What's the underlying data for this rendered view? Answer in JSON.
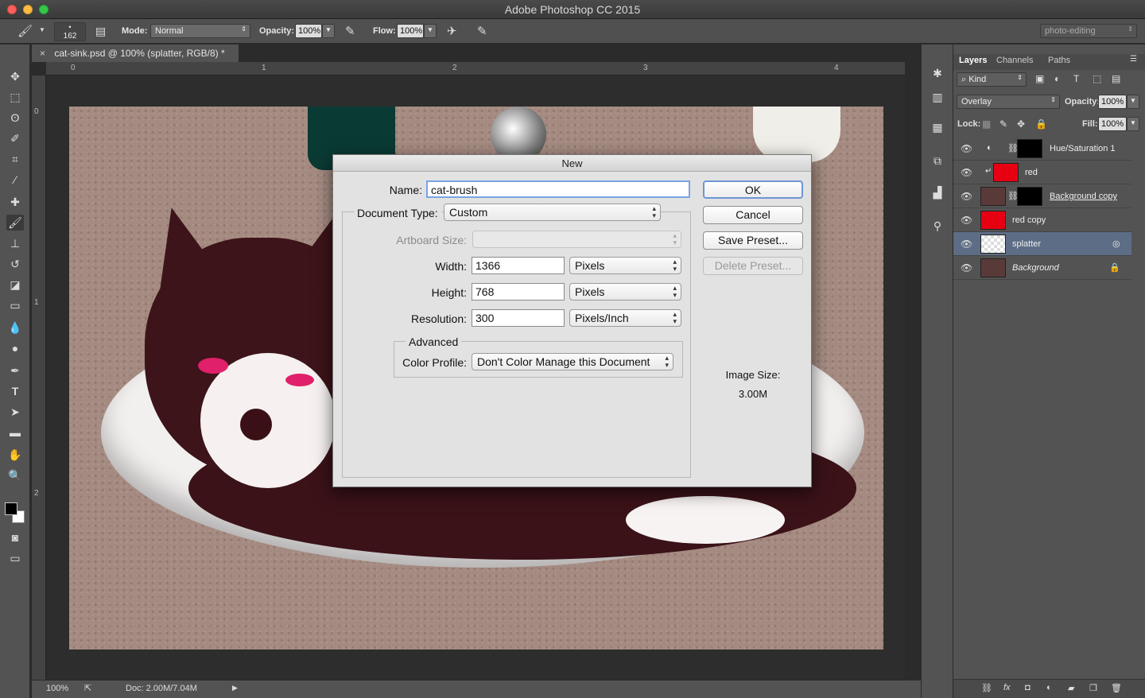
{
  "app": {
    "title": "Adobe Photoshop CC 2015"
  },
  "options_bar": {
    "brush_size": "162",
    "mode_label": "Mode:",
    "mode_value": "Normal",
    "opacity_label": "Opacity:",
    "opacity_value": "100%",
    "flow_label": "Flow:",
    "flow_value": "100%",
    "workspace": "photo-editing"
  },
  "document": {
    "tab_title": "cat-sink.psd @ 100% (splatter, RGB/8) *",
    "ruler_h": [
      "0",
      "1",
      "2",
      "3",
      "4"
    ],
    "ruler_v": [
      "0",
      "1",
      "2"
    ],
    "zoom": "100%",
    "doc_size": "Doc: 2.00M/7.04M"
  },
  "layers_panel": {
    "tabs": [
      "Layers",
      "Channels",
      "Paths"
    ],
    "filter": "Kind",
    "blend_mode": "Overlay",
    "opacity_label": "Opacity:",
    "opacity_value": "100%",
    "lock_label": "Lock:",
    "fill_label": "Fill:",
    "fill_value": "100%",
    "layers": [
      {
        "name": "Hue/Saturation 1"
      },
      {
        "name": "red"
      },
      {
        "name": "Background copy"
      },
      {
        "name": "red copy"
      },
      {
        "name": "splatter"
      },
      {
        "name": "Background"
      }
    ]
  },
  "dialog": {
    "title": "New",
    "name_label": "Name:",
    "name_value": "cat-brush",
    "doc_type_label": "Document Type:",
    "doc_type_value": "Custom",
    "artboard_label": "Artboard Size:",
    "width_label": "Width:",
    "width_value": "1366",
    "width_unit": "Pixels",
    "height_label": "Height:",
    "height_value": "768",
    "height_unit": "Pixels",
    "resolution_label": "Resolution:",
    "resolution_value": "300",
    "resolution_unit": "Pixels/Inch",
    "advanced_label": "Advanced",
    "color_profile_label": "Color Profile:",
    "color_profile_value": "Don't Color Manage this Document",
    "ok_label": "OK",
    "cancel_label": "Cancel",
    "save_preset_label": "Save Preset...",
    "delete_preset_label": "Delete Preset...",
    "image_size_label": "Image Size:",
    "image_size_value": "3.00M"
  }
}
